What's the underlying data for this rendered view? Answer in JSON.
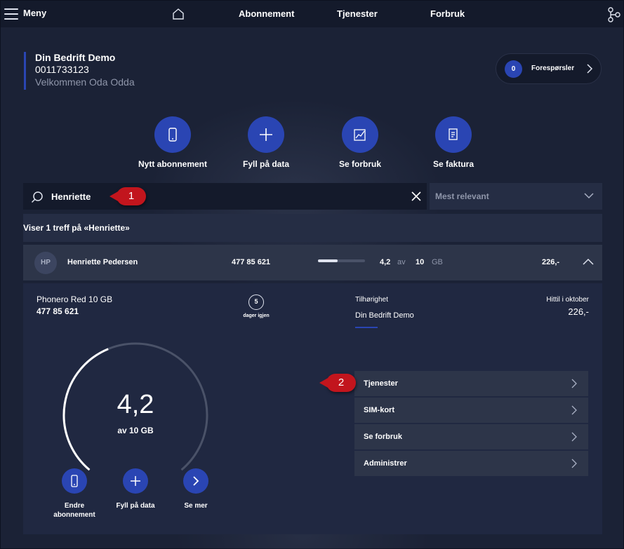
{
  "nav": {
    "menu_label": "Meny",
    "links": [
      "Abonnement",
      "Tjenester",
      "Forbruk"
    ]
  },
  "company": {
    "name": "Din Bedrift Demo",
    "number": "0011733123",
    "welcome": "Velkommen Oda Odda"
  },
  "requests": {
    "count": "0",
    "label": "Forespørsler"
  },
  "quick_actions": [
    {
      "label": "Nytt abonnement",
      "icon": "phone-icon"
    },
    {
      "label": "Fyll på data",
      "icon": "plus-icon"
    },
    {
      "label": "Se forbruk",
      "icon": "chart-icon"
    },
    {
      "label": "Se faktura",
      "icon": "invoice-icon"
    }
  ],
  "search": {
    "value": "Henriette",
    "placeholder": ""
  },
  "sort": {
    "selected": "Mest relevant"
  },
  "callouts": {
    "one": "1",
    "two": "2"
  },
  "results": {
    "summary": "Viser 1 treff på «Henriette»",
    "row": {
      "initials": "HP",
      "name": "Henriette Pedersen",
      "phone": "477 85 621",
      "used": "4,2",
      "of": "av",
      "total": "10",
      "unit": "GB",
      "usage_fraction": 0.42,
      "amount": "226,-"
    }
  },
  "detail": {
    "plan": "Phonero Red 10 GB",
    "phone": "477 85 621",
    "days_left": "5",
    "days_label": "dager igjen",
    "belonging_label": "Tilhørighet",
    "belonging_value": "Din Bedrift Demo",
    "until_label": "Hittil i oktober",
    "until_value": "226,-",
    "gauge_value": "4,2",
    "gauge_of": "av 10 GB",
    "gauge_fraction": 0.42,
    "actions": [
      {
        "label": "Endre abonnement",
        "icon": "phone-icon"
      },
      {
        "label": "Fyll på data",
        "icon": "plus-icon"
      },
      {
        "label": "Se mer",
        "icon": "chevron-right-icon"
      }
    ],
    "menu": [
      "Tjenester",
      "SIM-kort",
      "Se forbruk",
      "Administrer"
    ]
  }
}
